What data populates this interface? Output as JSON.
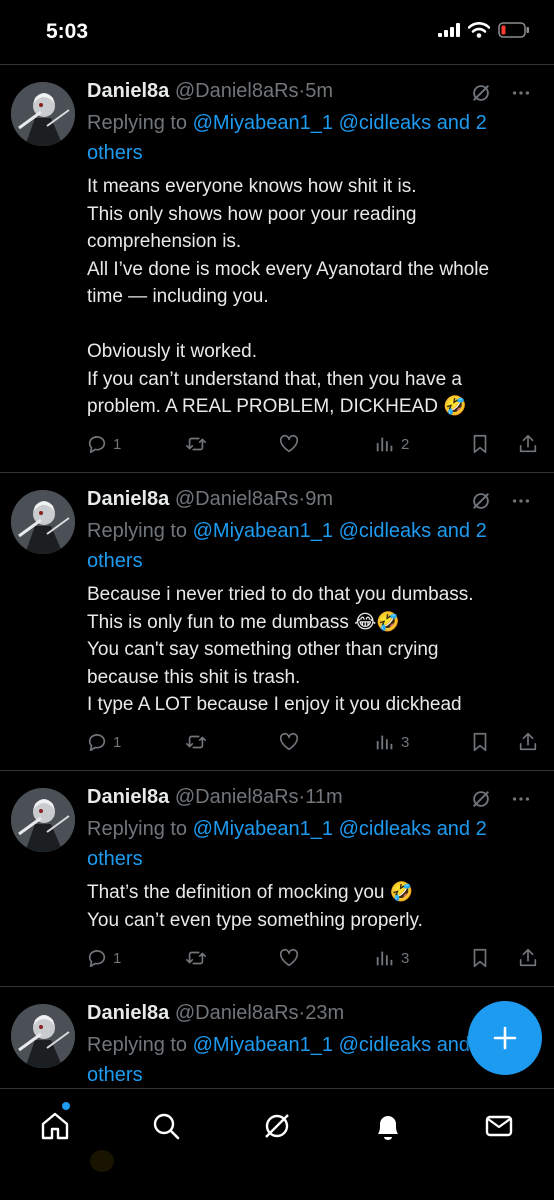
{
  "status_bar": {
    "time": "5:03"
  },
  "posts": [
    {
      "display_name": "Daniel8a",
      "handle": "@Daniel8aRs",
      "separator": "·",
      "time": "5m",
      "replying_prefix": "Replying to ",
      "reply_line1_links": "@Miyabean1_1 @cidleaks and 2",
      "reply_line2_link": "others",
      "lines": [
        "It means everyone knows how shit it is.",
        "This only shows how poor your reading",
        "comprehension is.",
        "All I’ve done is mock every Ayanotard the whole",
        "time — including you.",
        "",
        "Obviously it worked.",
        "If you can’t understand that, then you have a",
        "problem. A REAL PROBLEM, DICKHEAD 🤣"
      ],
      "reply_count": "1",
      "view_count": "2"
    },
    {
      "display_name": "Daniel8a",
      "handle": "@Daniel8aRs",
      "separator": "·",
      "time": "9m",
      "replying_prefix": "Replying to ",
      "reply_line1_links": "@Miyabean1_1 @cidleaks and 2",
      "reply_line2_link": "others",
      "lines": [
        "Because i never tried to do that you dumbass.",
        "This is only fun to me dumbass 😂🤣",
        "You can't say something other than crying",
        "because this shit is trash.",
        "I type A LOT because I enjoy it you dickhead"
      ],
      "reply_count": "1",
      "view_count": "3"
    },
    {
      "display_name": "Daniel8a",
      "handle": "@Daniel8aRs",
      "separator": "·",
      "time": "11m",
      "replying_prefix": "Replying to ",
      "reply_line1_links": "@Miyabean1_1 @cidleaks and 2",
      "reply_line2_link": "others",
      "lines": [
        "That’s the definition of mocking you 🤣",
        "You can’t even type something properly."
      ],
      "reply_count": "1",
      "view_count": "3"
    },
    {
      "display_name": "Daniel8a",
      "handle": "@Daniel8aRs",
      "separator": "·",
      "time": "23m",
      "replying_prefix": "Replying to ",
      "reply_line1_links": "@Miyabean1_1 @cidleaks and 2",
      "reply_line2_link": "others",
      "lines": []
    }
  ],
  "icons": {
    "status": [
      "cellular-signal-icon",
      "wifi-icon",
      "battery-low-icon"
    ],
    "post_header": [
      "grok-icon",
      "more-icon"
    ],
    "post_actions": [
      "reply-icon",
      "repost-icon",
      "like-icon",
      "views-icon",
      "bookmark-icon",
      "share-icon"
    ],
    "tabs": [
      "home-icon",
      "search-icon",
      "grok-icon",
      "notifications-icon",
      "messages-icon"
    ],
    "fab": "plus-icon"
  },
  "colors": {
    "background": "#000000",
    "text": "#e7e9ea",
    "muted": "#71767b",
    "link": "#1d9bf0",
    "fab": "#1d9bf0",
    "battery_low": "#ff3b30",
    "divider": "#2f3336"
  }
}
